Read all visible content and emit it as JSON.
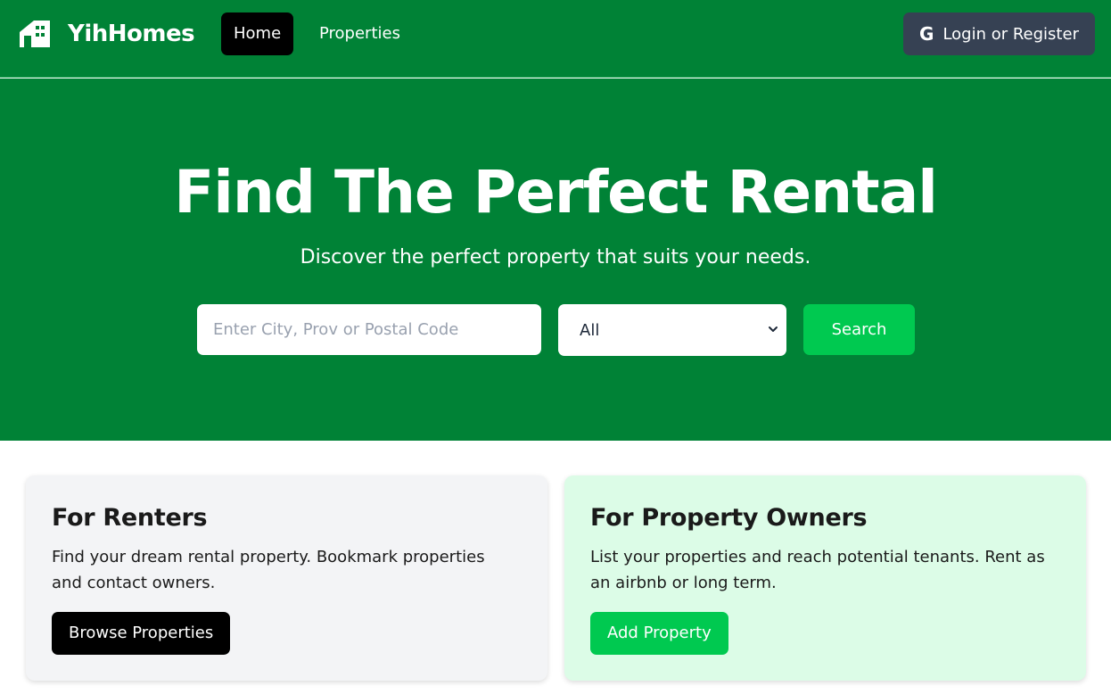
{
  "brand": {
    "name": "YihHomes",
    "logo_icon": "house-icon"
  },
  "nav": {
    "links": [
      {
        "label": "Home",
        "active": true
      },
      {
        "label": "Properties",
        "active": false
      }
    ],
    "login": {
      "icon": "google-icon",
      "glyph": "G",
      "label": "Login or Register"
    }
  },
  "hero": {
    "title": "Find The Perfect Rental",
    "subtitle": "Discover the perfect property that suits your needs.",
    "search": {
      "placeholder": "Enter City, Prov or Postal Code",
      "value": "",
      "type_selected": "All",
      "button_label": "Search"
    }
  },
  "cards": {
    "renters": {
      "title": "For Renters",
      "text": "Find your dream rental property. Bookmark properties and contact owners.",
      "button_label": "Browse Properties"
    },
    "owners": {
      "title": "For Property Owners",
      "text": "List your properties and reach potential tenants. Rent as an airbnb or long term.",
      "button_label": "Add Property"
    }
  },
  "colors": {
    "primary_green": "#008236",
    "accent_green": "#00c950",
    "dark_button": "#364153",
    "renter_card_bg": "#f3f4f6",
    "owner_card_bg": "#dcfce7"
  }
}
